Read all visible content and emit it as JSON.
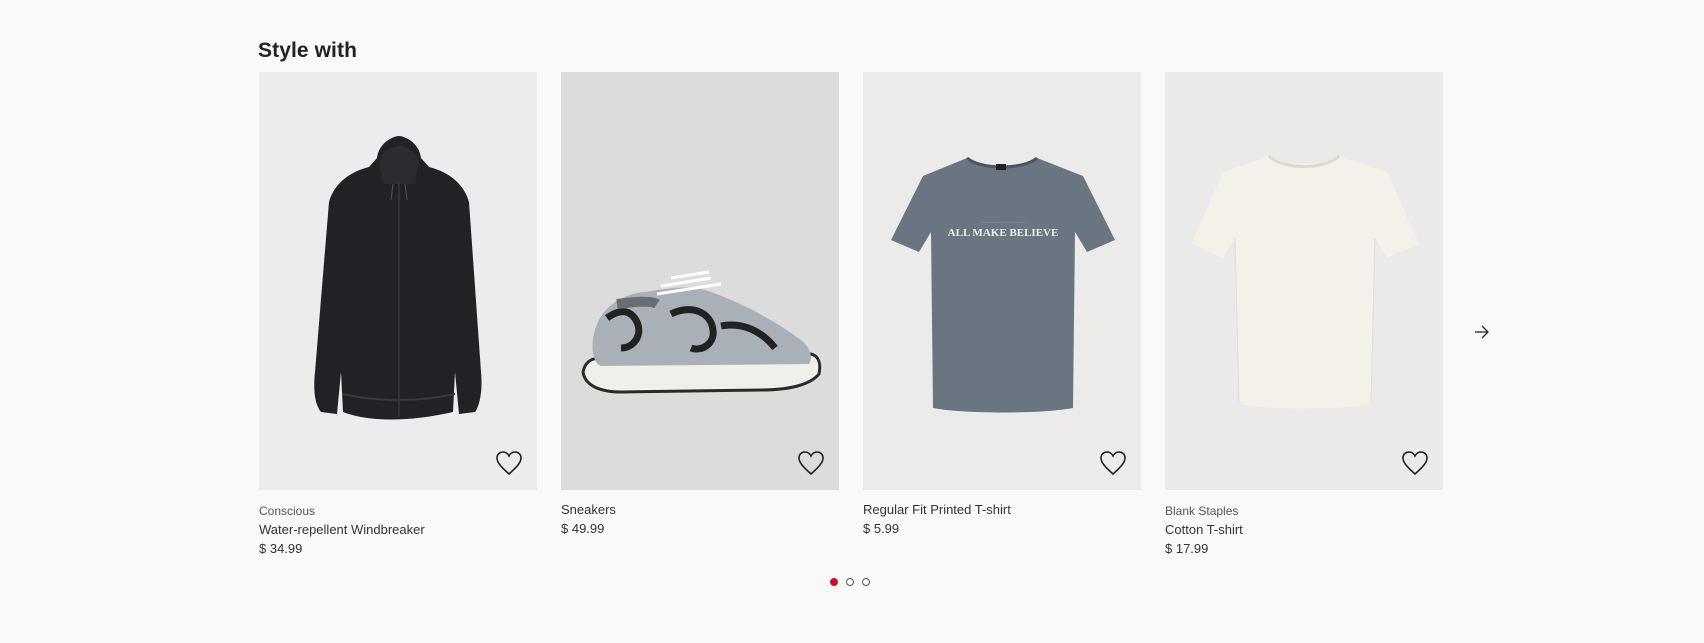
{
  "section": {
    "title": "Style with"
  },
  "products": [
    {
      "brand": "Conscious",
      "name": "Water-repellent Windbreaker",
      "price": "$ 34.99",
      "image_icon": "windbreaker-jacket-image",
      "bg": "#ececec"
    },
    {
      "brand": "",
      "name": "Sneakers",
      "price": "$ 49.99",
      "image_icon": "sneaker-image",
      "bg": "#dcdcdc"
    },
    {
      "brand": "",
      "name": "Regular Fit Printed T-shirt",
      "price": "$ 5.99",
      "image_icon": "printed-tshirt-image",
      "print_text": "ALL MAKE BELIEVE",
      "bg": "#ecebe9"
    },
    {
      "brand": "Blank Staples",
      "name": "Cotton T-shirt",
      "price": "$ 17.99",
      "image_icon": "cotton-tshirt-image",
      "bg": "#eaeaea"
    }
  ],
  "carousel": {
    "next_icon": "arrow-right-icon",
    "pages": 3,
    "active_page": 1,
    "active_color": "#c8102e"
  },
  "favorite_icon": "heart-outline-icon"
}
